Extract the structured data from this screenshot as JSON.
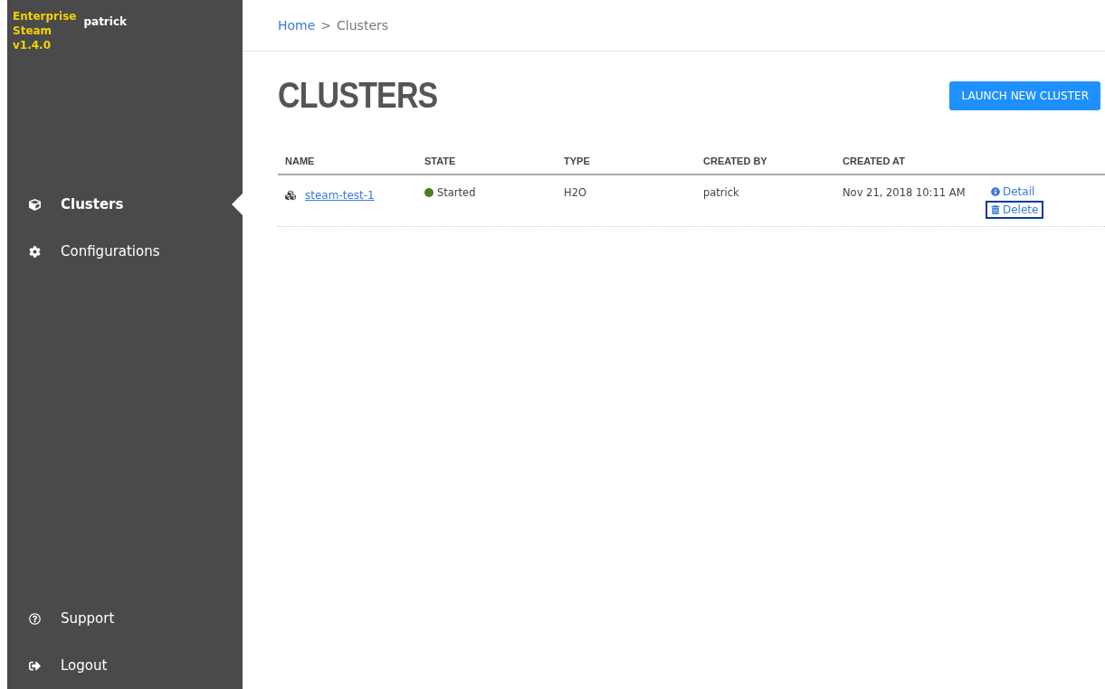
{
  "sidebar": {
    "brand": [
      "Enterprise",
      "Steam",
      "v1.4.0"
    ],
    "user": "patrick",
    "items": [
      {
        "label": "Clusters",
        "kind": "cube",
        "selected": true
      },
      {
        "label": "Configurations",
        "kind": "gear",
        "selected": false
      }
    ],
    "bottom_items": [
      {
        "label": "Support",
        "kind": "help"
      },
      {
        "label": "Logout",
        "kind": "logout"
      }
    ]
  },
  "breadcrumb": [
    {
      "label": "Home",
      "kind": "link"
    },
    {
      "label": ">",
      "kind": "separator"
    },
    {
      "label": "Clusters",
      "kind": "current"
    }
  ],
  "title": "CLUSTERS",
  "launch_button": "LAUNCH NEW CLUSTER",
  "table": {
    "columns": [
      "NAME",
      "STATE",
      "TYPE",
      "CREATED BY",
      "CREATED AT"
    ],
    "rows": [
      {
        "name": "steam-test-1",
        "state": "Started",
        "color": "#4e7f1f",
        "type": "H2O",
        "created_by": "patrick",
        "created_at": "Nov 21, 2018 10:11 AM",
        "actions": [
          {
            "label": "Detail",
            "kind": "info",
            "highlighted": false
          },
          {
            "label": "Delete",
            "kind": "trash",
            "highlighted": true
          }
        ]
      }
    ]
  }
}
